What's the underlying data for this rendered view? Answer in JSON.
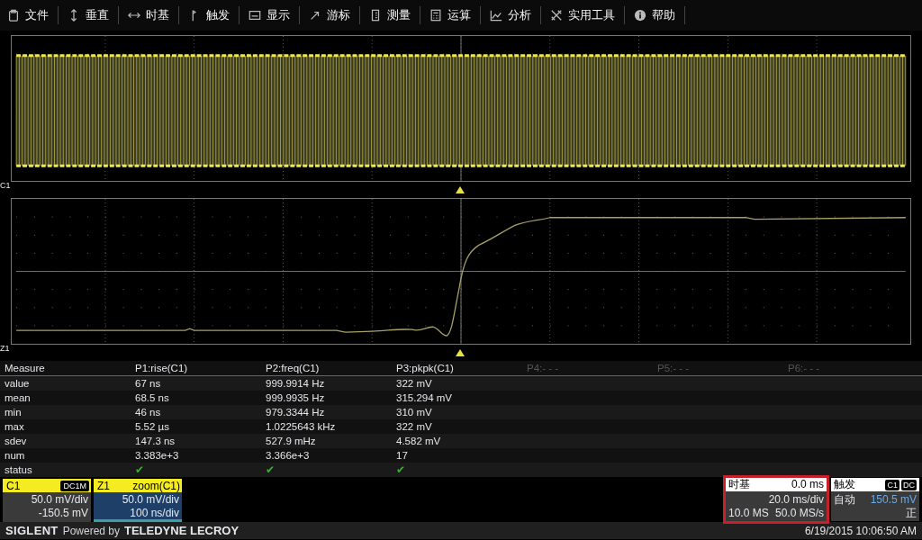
{
  "menu": [
    {
      "label": "文件"
    },
    {
      "label": "垂直"
    },
    {
      "label": "时基"
    },
    {
      "label": "触发"
    },
    {
      "label": "显示"
    },
    {
      "label": "游标"
    },
    {
      "label": "测量"
    },
    {
      "label": "运算"
    },
    {
      "label": "分析"
    },
    {
      "label": "实用工具"
    },
    {
      "label": "帮助"
    }
  ],
  "main_panel": {
    "channel_label": "C1"
  },
  "zoom_panel": {
    "channel_label": "Z1"
  },
  "measure": {
    "header": "Measure",
    "columns": [
      {
        "label": "P1:rise(C1)",
        "disabled": false
      },
      {
        "label": "P2:freq(C1)",
        "disabled": false
      },
      {
        "label": "P3:pkpk(C1)",
        "disabled": false
      },
      {
        "label": "P4:- - -",
        "disabled": true
      },
      {
        "label": "P5:- - -",
        "disabled": true
      },
      {
        "label": "P6:- - -",
        "disabled": true
      }
    ],
    "rows": [
      {
        "kind": "text",
        "label": "value",
        "cells": [
          "67 ns",
          "999.9914 Hz",
          "322 mV"
        ]
      },
      {
        "kind": "text",
        "label": "mean",
        "cells": [
          "68.5 ns",
          "999.9935 Hz",
          "315.294 mV"
        ]
      },
      {
        "kind": "text",
        "label": "min",
        "cells": [
          "46 ns",
          "979.3344 Hz",
          "310 mV"
        ]
      },
      {
        "kind": "text",
        "label": "max",
        "cells": [
          "5.52 µs",
          "1.0225643 kHz",
          "322 mV"
        ]
      },
      {
        "kind": "text",
        "label": "sdev",
        "cells": [
          "147.3 ns",
          "527.9 mHz",
          "4.582 mV"
        ]
      },
      {
        "kind": "text",
        "label": "num",
        "cells": [
          "3.383e+3",
          "3.366e+3",
          "17"
        ]
      },
      {
        "kind": "status",
        "label": "status",
        "cells": [
          "✔",
          "✔",
          "✔"
        ]
      }
    ]
  },
  "channels": [
    {
      "kind": "channel",
      "name": "C1",
      "tag": "DC1M",
      "line_1": "50.0 mV/div",
      "line_2": "-150.5 mV"
    },
    {
      "kind": "zoom",
      "name": "Z1",
      "tag": "zoom(C1)",
      "line_1": "50.0 mV/div",
      "line_2": "100 ns/div"
    }
  ],
  "timebase": {
    "title": "时基",
    "delay": "0.0 ms",
    "scale": "20.0 ms/div",
    "memory": "10.0 MS",
    "sample_rate": "50.0 MS/s",
    "highlighted": true
  },
  "trigger": {
    "title": "触发",
    "source": "C1",
    "coupling": "DC",
    "mode": "自动",
    "trigger_level": "150.5 mV",
    "slope": "正"
  },
  "footer": {
    "brand": "SIGLENT",
    "powered_by": "Powered by",
    "partner": "TELEDYNE LECROY",
    "datetime": "6/19/2015 10:06:50 AM"
  }
}
